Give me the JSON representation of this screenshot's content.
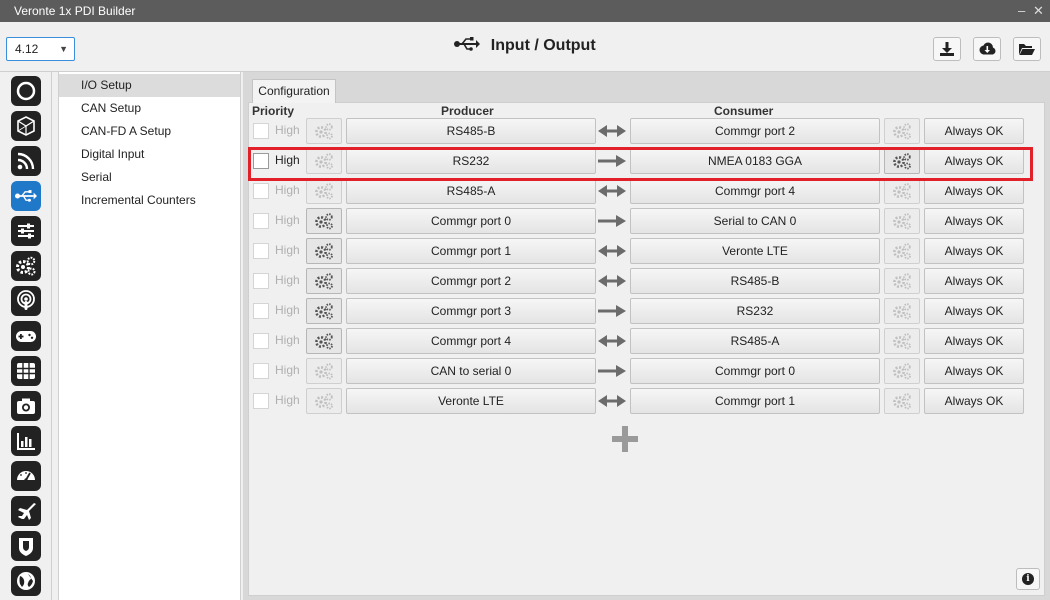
{
  "window": {
    "title": "Veronte 1x PDI Builder",
    "minimize": "–",
    "close": "✕"
  },
  "toolbar": {
    "version": "4.12",
    "heading": "Input / Output",
    "buttons": [
      "download-icon",
      "cloud-download-icon",
      "folder-open-icon"
    ]
  },
  "sidebar": {
    "items": [
      {
        "label": "I/O Setup",
        "selected": true
      },
      {
        "label": "CAN Setup",
        "selected": false
      },
      {
        "label": "CAN-FD A Setup",
        "selected": false
      },
      {
        "label": "Digital Input",
        "selected": false
      },
      {
        "label": "Serial",
        "selected": false
      },
      {
        "label": "Incremental Counters",
        "selected": false
      }
    ]
  },
  "tabs": [
    {
      "label": "Configuration",
      "active": true
    }
  ],
  "headers": {
    "priority": "Priority",
    "producer": "Producer",
    "consumer": "Consumer"
  },
  "rows": [
    {
      "priority": "High",
      "enabled": false,
      "producer": "RS485-B",
      "direction": "bidirectional",
      "consumer": "Commgr port 2",
      "producer_gear": false,
      "consumer_gear": false,
      "status": "Always OK"
    },
    {
      "priority": "High",
      "enabled": true,
      "producer": "RS232",
      "direction": "forward",
      "consumer": "NMEA 0183 GGA",
      "producer_gear": false,
      "consumer_gear": true,
      "status": "Always OK"
    },
    {
      "priority": "High",
      "enabled": false,
      "producer": "RS485-A",
      "direction": "bidirectional",
      "consumer": "Commgr port 4",
      "producer_gear": false,
      "consumer_gear": false,
      "status": "Always OK"
    },
    {
      "priority": "High",
      "enabled": false,
      "producer": "Commgr port 0",
      "direction": "forward",
      "consumer": "Serial to CAN 0",
      "producer_gear": true,
      "consumer_gear": false,
      "status": "Always OK"
    },
    {
      "priority": "High",
      "enabled": false,
      "producer": "Commgr port 1",
      "direction": "bidirectional",
      "consumer": "Veronte LTE",
      "producer_gear": true,
      "consumer_gear": false,
      "status": "Always OK"
    },
    {
      "priority": "High",
      "enabled": false,
      "producer": "Commgr port 2",
      "direction": "bidirectional",
      "consumer": "RS485-B",
      "producer_gear": true,
      "consumer_gear": false,
      "status": "Always OK"
    },
    {
      "priority": "High",
      "enabled": false,
      "producer": "Commgr port 3",
      "direction": "forward",
      "consumer": "RS232",
      "producer_gear": true,
      "consumer_gear": false,
      "status": "Always OK"
    },
    {
      "priority": "High",
      "enabled": false,
      "producer": "Commgr port 4",
      "direction": "bidirectional",
      "consumer": "RS485-A",
      "producer_gear": true,
      "consumer_gear": false,
      "status": "Always OK"
    },
    {
      "priority": "High",
      "enabled": false,
      "producer": "CAN to serial 0",
      "direction": "forward",
      "consumer": "Commgr port 0",
      "producer_gear": false,
      "consumer_gear": false,
      "status": "Always OK"
    },
    {
      "priority": "High",
      "enabled": false,
      "producer": "Veronte LTE",
      "direction": "bidirectional",
      "consumer": "Commgr port 1",
      "producer_gear": false,
      "consumer_gear": false,
      "status": "Always OK"
    }
  ],
  "iconbar": [
    "circle-icon",
    "polygon-sphere-icon",
    "rss-icon",
    "usb-icon",
    "sliders-icon",
    "gears-icon",
    "podcast-icon",
    "gamepad-icon",
    "grid-icon",
    "camera-icon",
    "bar-chart-icon",
    "gauge-icon",
    "plane-icon",
    "shield-icon",
    "globe-icon"
  ],
  "add_icon": "plus-icon",
  "info_icon": "info-icon",
  "highlighted_row": 1,
  "colors": {
    "active": "#1f78c8",
    "highlight": "#e1202a",
    "arrow": "#6b6b6b"
  }
}
